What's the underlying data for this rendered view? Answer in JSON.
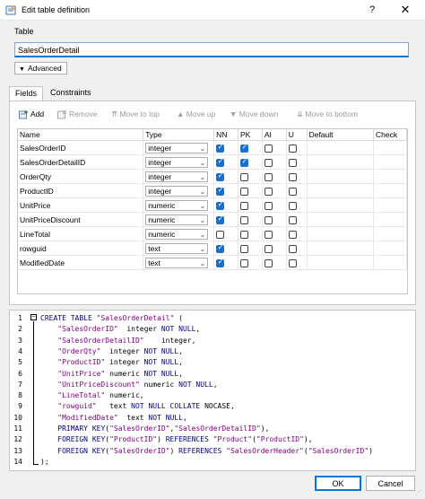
{
  "window": {
    "title": "Edit table definition",
    "help": "?",
    "close": "✕"
  },
  "table_group_label": "Table",
  "table_name": "SalesOrderDetail",
  "advanced_label": "Advanced",
  "tabs": [
    {
      "label": "Fields"
    },
    {
      "label": "Constraints"
    }
  ],
  "toolbar": {
    "add": "Add",
    "remove": "Remove",
    "move_to_top": "Move to top",
    "move_up": "Move up",
    "move_down": "Move down",
    "move_to_bottom": "Move to bottom"
  },
  "columns": [
    "Name",
    "Type",
    "NN",
    "PK",
    "AI",
    "U",
    "Default",
    "Check"
  ],
  "fields": [
    {
      "name": "SalesOrderID",
      "type": "integer",
      "nn": true,
      "pk": true,
      "ai": false,
      "u": false
    },
    {
      "name": "SalesOrderDetailID",
      "type": "integer",
      "nn": true,
      "pk": true,
      "ai": false,
      "u": false
    },
    {
      "name": "OrderQty",
      "type": "integer",
      "nn": true,
      "pk": false,
      "ai": false,
      "u": false
    },
    {
      "name": "ProductID",
      "type": "integer",
      "nn": true,
      "pk": false,
      "ai": false,
      "u": false
    },
    {
      "name": "UnitPrice",
      "type": "numeric",
      "nn": true,
      "pk": false,
      "ai": false,
      "u": false
    },
    {
      "name": "UnitPriceDiscount",
      "type": "numeric",
      "nn": true,
      "pk": false,
      "ai": false,
      "u": false
    },
    {
      "name": "LineTotal",
      "type": "numeric",
      "nn": false,
      "pk": false,
      "ai": false,
      "u": false
    },
    {
      "name": "rowguid",
      "type": "text",
      "nn": true,
      "pk": false,
      "ai": false,
      "u": false
    },
    {
      "name": "ModifiedDate",
      "type": "text",
      "nn": true,
      "pk": false,
      "ai": false,
      "u": false
    }
  ],
  "sql_lines": [
    "CREATE TABLE \"SalesOrderDetail\" (",
    "    \"SalesOrderID\"  integer NOT NULL,",
    "    \"SalesOrderDetailID\"    integer,",
    "    \"OrderQty\"  integer NOT NULL,",
    "    \"ProductID\" integer NOT NULL,",
    "    \"UnitPrice\" numeric NOT NULL,",
    "    \"UnitPriceDiscount\" numeric NOT NULL,",
    "    \"LineTotal\" numeric,",
    "    \"rowguid\"   text NOT NULL COLLATE NOCASE,",
    "    \"ModifiedDate\"  text NOT NULL,",
    "    PRIMARY KEY(\"SalesOrderID\",\"SalesOrderDetailID\"),",
    "    FOREIGN KEY(\"ProductID\") REFERENCES \"Product\"(\"ProductID\"),",
    "    FOREIGN KEY(\"SalesOrderID\") REFERENCES \"SalesOrderHeader\"(\"SalesOrderID\")",
    ");"
  ],
  "buttons": {
    "ok": "OK",
    "cancel": "Cancel"
  },
  "colors": {
    "accent": "#0078d7",
    "checkbox": "#1a6fd0",
    "keyword": "#00008b",
    "string": "#800080"
  }
}
